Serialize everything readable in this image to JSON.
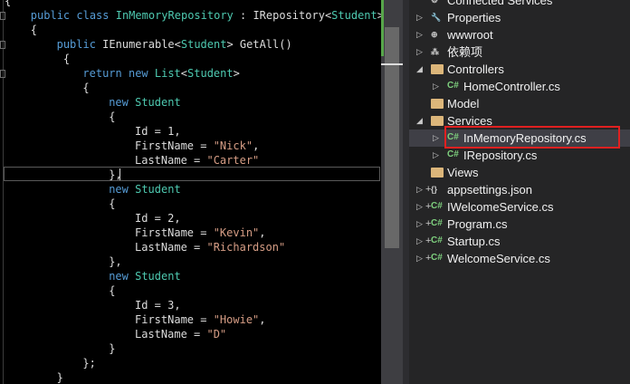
{
  "code": [
    {
      "indent": 0,
      "parts": [
        {
          "t": "p",
          "v": "{"
        }
      ]
    },
    {
      "indent": 2,
      "parts": [
        {
          "t": "kw",
          "v": "public class "
        },
        {
          "t": "ty",
          "v": "InMemoryRepository"
        },
        {
          "t": "p",
          "v": " : "
        },
        {
          "t": "p",
          "v": "IRepository"
        },
        {
          "t": "p",
          "v": "<"
        },
        {
          "t": "ty",
          "v": "Student"
        },
        {
          "t": "p",
          "v": ">"
        }
      ]
    },
    {
      "indent": 2,
      "parts": [
        {
          "t": "p",
          "v": "{"
        }
      ]
    },
    {
      "indent": 4,
      "parts": [
        {
          "t": "kw",
          "v": "public "
        },
        {
          "t": "p",
          "v": "IEnumerable<"
        },
        {
          "t": "ty",
          "v": "Student"
        },
        {
          "t": "p",
          "v": "> GetAll()"
        }
      ]
    },
    {
      "indent": 4,
      "parts": [
        {
          "t": "p",
          "v": " {"
        }
      ]
    },
    {
      "indent": 6,
      "parts": [
        {
          "t": "kw",
          "v": "return new "
        },
        {
          "t": "ty",
          "v": "List"
        },
        {
          "t": "p",
          "v": "<"
        },
        {
          "t": "ty",
          "v": "Student"
        },
        {
          "t": "p",
          "v": ">"
        }
      ]
    },
    {
      "indent": 6,
      "parts": [
        {
          "t": "p",
          "v": "{"
        }
      ]
    },
    {
      "indent": 8,
      "parts": [
        {
          "t": "kw",
          "v": "new "
        },
        {
          "t": "ty",
          "v": "Student"
        }
      ]
    },
    {
      "indent": 8,
      "parts": [
        {
          "t": "p",
          "v": "{"
        }
      ]
    },
    {
      "indent": 10,
      "parts": [
        {
          "t": "p",
          "v": "Id = 1,"
        }
      ]
    },
    {
      "indent": 10,
      "parts": [
        {
          "t": "p",
          "v": "FirstName = "
        },
        {
          "t": "st",
          "v": "\"Nick\""
        },
        {
          "t": "p",
          "v": ","
        }
      ]
    },
    {
      "indent": 10,
      "parts": [
        {
          "t": "p",
          "v": "LastName = "
        },
        {
          "t": "st",
          "v": "\"Carter\""
        }
      ]
    },
    {
      "indent": 8,
      "parts": [
        {
          "t": "p",
          "v": "},"
        }
      ]
    },
    {
      "indent": 8,
      "parts": [
        {
          "t": "kw",
          "v": "new "
        },
        {
          "t": "ty",
          "v": "Student"
        }
      ]
    },
    {
      "indent": 8,
      "parts": [
        {
          "t": "p",
          "v": "{"
        }
      ]
    },
    {
      "indent": 10,
      "parts": [
        {
          "t": "p",
          "v": "Id = 2,"
        }
      ]
    },
    {
      "indent": 10,
      "parts": [
        {
          "t": "p",
          "v": "FirstName = "
        },
        {
          "t": "st",
          "v": "\"Kevin\""
        },
        {
          "t": "p",
          "v": ","
        }
      ]
    },
    {
      "indent": 10,
      "parts": [
        {
          "t": "p",
          "v": "LastName = "
        },
        {
          "t": "st",
          "v": "\"Richardson\""
        }
      ]
    },
    {
      "indent": 8,
      "parts": [
        {
          "t": "p",
          "v": "},"
        }
      ]
    },
    {
      "indent": 8,
      "parts": [
        {
          "t": "kw",
          "v": "new "
        },
        {
          "t": "ty",
          "v": "Student"
        }
      ]
    },
    {
      "indent": 8,
      "parts": [
        {
          "t": "p",
          "v": "{"
        }
      ]
    },
    {
      "indent": 10,
      "parts": [
        {
          "t": "p",
          "v": "Id = 3,"
        }
      ]
    },
    {
      "indent": 10,
      "parts": [
        {
          "t": "p",
          "v": "FirstName = "
        },
        {
          "t": "st",
          "v": "\"Howie\""
        },
        {
          "t": "p",
          "v": ","
        }
      ]
    },
    {
      "indent": 10,
      "parts": [
        {
          "t": "p",
          "v": "LastName = "
        },
        {
          "t": "st",
          "v": "\"D\""
        }
      ]
    },
    {
      "indent": 8,
      "parts": [
        {
          "t": "p",
          "v": "}"
        }
      ]
    },
    {
      "indent": 6,
      "parts": [
        {
          "t": "p",
          "v": "};"
        }
      ]
    },
    {
      "indent": 4,
      "parts": [
        {
          "t": "p",
          "v": "}"
        }
      ]
    }
  ],
  "explorer": {
    "items": [
      {
        "label": "Connected Services",
        "level": 1,
        "arrow": "",
        "plus": "",
        "icon": "connected-services-icon",
        "glyph": "⚙",
        "color": "#c8c8c8"
      },
      {
        "label": "Properties",
        "level": 1,
        "arrow": "▷",
        "plus": "",
        "icon": "wrench-icon",
        "glyph": "🔧",
        "color": "#c8c8c8"
      },
      {
        "label": "wwwroot",
        "level": 1,
        "arrow": "▷",
        "plus": "",
        "icon": "globe-icon",
        "glyph": "⊕",
        "color": "#c8c8c8"
      },
      {
        "label": "依赖项",
        "level": 1,
        "arrow": "▷",
        "plus": "",
        "icon": "dependencies-icon",
        "glyph": "⁂",
        "color": "#c8c8c8"
      },
      {
        "label": "Controllers",
        "level": 1,
        "arrow": "◢",
        "plus": "",
        "icon": "folder-icon",
        "glyph": "",
        "color": ""
      },
      {
        "label": "HomeController.cs",
        "level": 2,
        "arrow": "▷",
        "plus": "",
        "icon": "csharp-file-icon",
        "glyph": "C#",
        "color": "#7ed07e"
      },
      {
        "label": "Model",
        "level": 1,
        "arrow": "",
        "plus": "",
        "icon": "folder-icon",
        "glyph": "",
        "color": ""
      },
      {
        "label": "Services",
        "level": 1,
        "arrow": "◢",
        "plus": "",
        "icon": "folder-icon",
        "glyph": "",
        "color": ""
      },
      {
        "label": "InMemoryRepository.cs",
        "level": 2,
        "arrow": "▷",
        "plus": "",
        "icon": "csharp-file-icon",
        "glyph": "C#",
        "color": "#7ed07e"
      },
      {
        "label": "IRepository.cs",
        "level": 2,
        "arrow": "▷",
        "plus": "",
        "icon": "csharp-file-icon",
        "glyph": "C#",
        "color": "#7ed07e"
      },
      {
        "label": "Views",
        "level": 1,
        "arrow": "",
        "plus": "",
        "icon": "folder-icon",
        "glyph": "",
        "color": ""
      },
      {
        "label": "appsettings.json",
        "level": 1,
        "arrow": "▷",
        "plus": "+",
        "icon": "json-file-icon",
        "glyph": "{}",
        "color": "#c8c8c8"
      },
      {
        "label": "IWelcomeService.cs",
        "level": 1,
        "arrow": "▷",
        "plus": "+",
        "icon": "csharp-file-icon",
        "glyph": "C#",
        "color": "#7ed07e"
      },
      {
        "label": "Program.cs",
        "level": 1,
        "arrow": "▷",
        "plus": "+",
        "icon": "csharp-file-icon",
        "glyph": "C#",
        "color": "#7ed07e"
      },
      {
        "label": "Startup.cs",
        "level": 1,
        "arrow": "▷",
        "plus": "+",
        "icon": "csharp-file-icon",
        "glyph": "C#",
        "color": "#7ed07e"
      },
      {
        "label": "WelcomeService.cs",
        "level": 1,
        "arrow": "▷",
        "plus": "+",
        "icon": "csharp-file-icon",
        "glyph": "C#",
        "color": "#7ed07e"
      }
    ],
    "selected_index": 8
  },
  "colors": {
    "keyword": "#569cd6",
    "type": "#4ec9b0",
    "string": "#d69d85",
    "highlight": "#e02020"
  }
}
